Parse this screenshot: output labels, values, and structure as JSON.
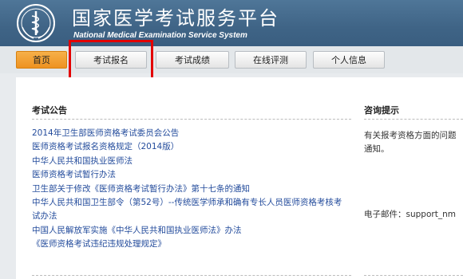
{
  "header": {
    "title": "国家医学考试服务平台",
    "subtitle": "National Medical Examination Service System",
    "colors": {
      "banner": "#3f6486",
      "nav_active": "#ee9220",
      "link": "#244c9c",
      "highlight": "#e30000"
    }
  },
  "nav": {
    "tabs": [
      {
        "label": "首页",
        "active": true
      },
      {
        "label": "考试报名",
        "active": false
      },
      {
        "label": "考试成绩",
        "active": false
      },
      {
        "label": "在线评测",
        "active": false
      },
      {
        "label": "个人信息",
        "active": false
      }
    ]
  },
  "notices": {
    "title": "考试公告",
    "items": [
      "2014年卫生部医师资格考试委员会公告",
      "医师资格考试报名资格规定（2014版）",
      "中华人民共和国执业医师法",
      "医师资格考试暂行办法",
      "卫生部关于修改《医师资格考试暂行办法》第十七条的通知",
      "中华人民共和国卫生部令（第52号）--传统医学师承和确有专长人员医师资格考核考试办法",
      "中国人民解放军实施《中华人民共和国执业医师法》办法",
      "《医师资格考试违纪违规处理规定》"
    ]
  },
  "consult": {
    "title": "咨询提示",
    "lines": [
      "有关报考资格方面的问题",
      "通知。"
    ],
    "email": "电子邮件：support_nm"
  }
}
